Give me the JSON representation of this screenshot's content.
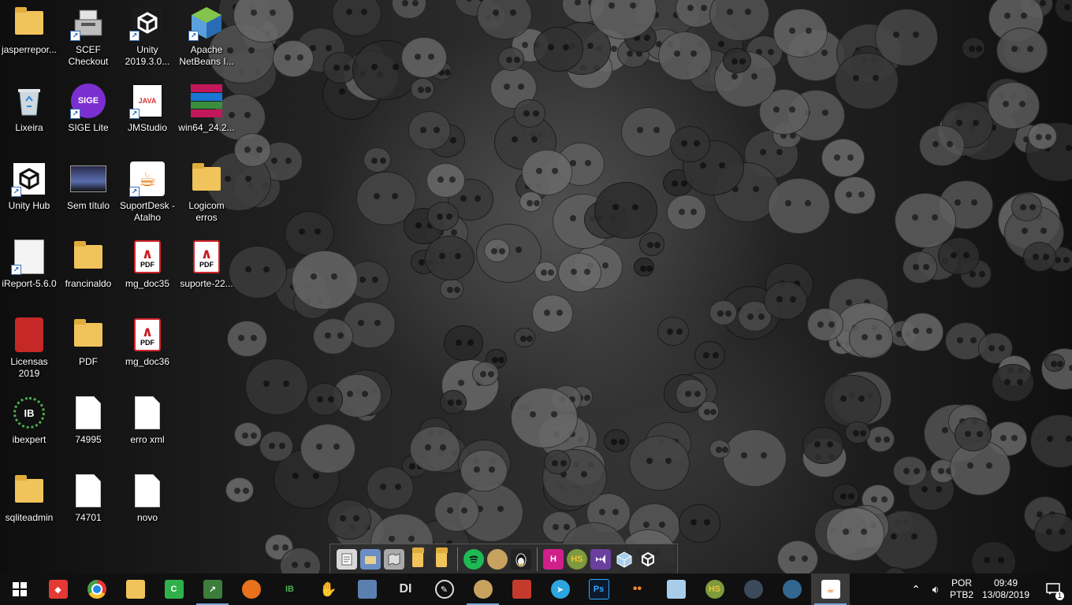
{
  "desktop": {
    "icons": [
      {
        "label": "jasperrepor...",
        "icon": "folder-icon"
      },
      {
        "label": "SCEF\nCheckout",
        "icon": "cash-register-icon"
      },
      {
        "label": "Unity\n2019.3.0...",
        "icon": "unity-icon"
      },
      {
        "label": "Apache\nNetBeans I...",
        "icon": "netbeans-icon"
      },
      {
        "label": "Lixeira",
        "icon": "recycle-bin-icon"
      },
      {
        "label": "SIGE Lite",
        "icon": "sige-lite-icon"
      },
      {
        "label": "JMStudio",
        "icon": "jmstudio-icon"
      },
      {
        "label": "win64_24.2...",
        "icon": "winrar-icon"
      },
      {
        "label": "Unity Hub",
        "icon": "unity-hub-icon"
      },
      {
        "label": "Sem título",
        "icon": "image-thumbnail-icon"
      },
      {
        "label": "SuportDesk -\nAtalho",
        "icon": "java-icon"
      },
      {
        "label": "Logicom\nerros",
        "icon": "folder-icon"
      },
      {
        "label": "iReport-5.6.0",
        "icon": "ireport-icon"
      },
      {
        "label": "francinaldo",
        "icon": "folder-icon"
      },
      {
        "label": "mg_doc35",
        "icon": "pdf-icon"
      },
      {
        "label": "suporte-22...",
        "icon": "pdf-icon"
      },
      {
        "label": "Licensas 2019",
        "icon": "license-icon"
      },
      {
        "label": "PDF",
        "icon": "folder-icon"
      },
      {
        "label": "mg_doc36",
        "icon": "pdf-icon"
      },
      {
        "label": "ibexpert",
        "icon": "ibexpert-icon"
      },
      {
        "label": "74995",
        "icon": "blank-file-icon"
      },
      {
        "label": "erro xml",
        "icon": "blank-file-icon"
      },
      {
        "label": "sqliteadmin",
        "icon": "folder-icon"
      },
      {
        "label": "74701",
        "icon": "blank-file-icon"
      },
      {
        "label": "novo",
        "icon": "blank-file-icon"
      }
    ]
  },
  "pdf_badge": "PDF",
  "unity_badge": "IB",
  "sige_badge": "SIGE",
  "quick_tray": {
    "items": [
      "notepad-icon",
      "folder-view-icon",
      "map-icon",
      "folder-icon",
      "folder-icon",
      "spotify-icon",
      "paint-icon",
      "linux-tux-icon",
      "hs-icon",
      "hs-icon",
      "visual-studio-icon",
      "box-icon",
      "unity-icon"
    ],
    "hs_label": "HS"
  },
  "taskbar": {
    "ps_label": "Ps",
    "di_label": "DI",
    "hs_label": "HS",
    "lang_top": "POR",
    "lang_bottom": "PTB2",
    "time": "09:49",
    "date": "13/08/2019",
    "notification_count": "1"
  },
  "colors": {
    "taskbar": "#101010",
    "accent": "#7aa7d8"
  }
}
